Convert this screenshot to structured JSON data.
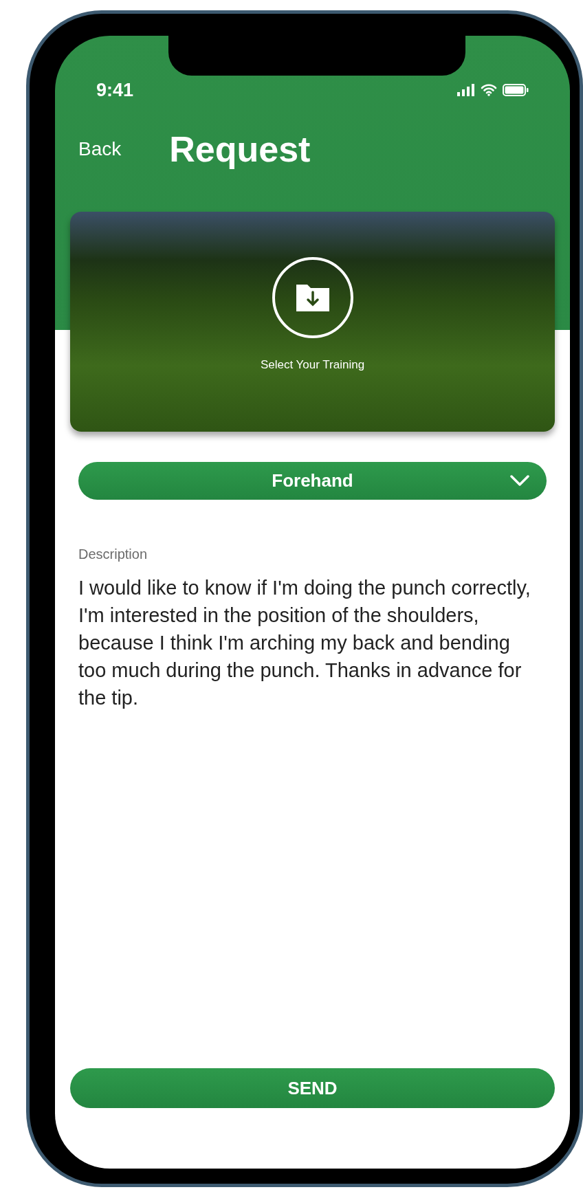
{
  "status_bar": {
    "time": "9:41"
  },
  "header": {
    "back": "Back",
    "title": "Request"
  },
  "training_card": {
    "label": "Select Your Training"
  },
  "training_select": {
    "value": "Forehand"
  },
  "description": {
    "label": "Description",
    "value": "I would like to know if I'm doing the punch correctly, I'm interested in the position of the shoulders, because I think I'm arching my back and bending too much during the punch. Thanks in advance for the tip."
  },
  "send_button": "SEND"
}
